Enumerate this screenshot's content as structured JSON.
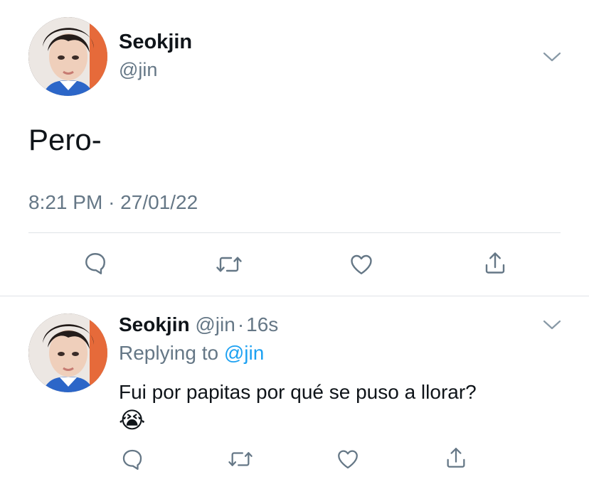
{
  "main_tweet": {
    "author_name": "Seokjin",
    "author_handle": "@jin",
    "text": "Pero-",
    "time": "8:21 PM",
    "separator": "·",
    "date": "27/01/22"
  },
  "reply_tweet": {
    "author_name": "Seokjin",
    "author_handle": "@jin",
    "dot": "·",
    "age": "16s",
    "replying_label": "Replying to",
    "replying_handle": "@jin",
    "text": "Fui por papitas por qué se puso a llorar?",
    "emoji": "😭"
  },
  "icons": {
    "more": "chevron-down-icon",
    "reply": "comment-icon",
    "retweet": "retweet-icon",
    "like": "heart-icon",
    "share": "share-icon"
  },
  "colors": {
    "text": "#0f1419",
    "muted": "#657786",
    "link": "#1da1f2",
    "divider": "#dfe3e7"
  }
}
